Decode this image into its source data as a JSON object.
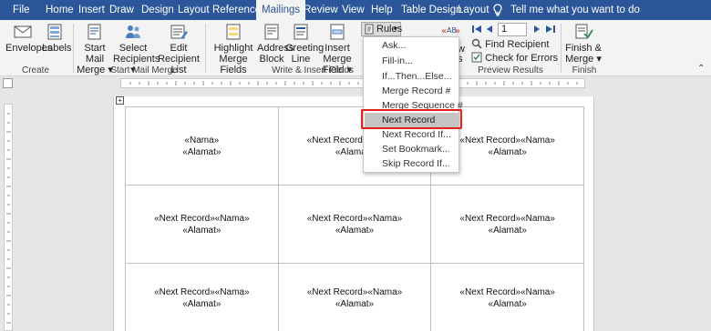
{
  "tabs": [
    {
      "label": "File",
      "left": 0
    },
    {
      "label": "Home"
    },
    {
      "label": "Insert"
    },
    {
      "label": "Draw"
    },
    {
      "label": "Design"
    },
    {
      "label": "Layout"
    },
    {
      "label": "References"
    },
    {
      "label": "Mailings",
      "active": true
    },
    {
      "label": "Review"
    },
    {
      "label": "View"
    },
    {
      "label": "Help"
    },
    {
      "label": "Table Design"
    },
    {
      "label": "Layout"
    }
  ],
  "tell_me": "Tell me what you want to do",
  "ribbon": {
    "create": {
      "envelopes": "Envelopes",
      "labels": "Labels",
      "group": "Create"
    },
    "start_mail_merge": {
      "start_mail": "Start Mail",
      "merge": "Merge",
      "select": "Select",
      "recipients": "Recipients",
      "edit": "Edit",
      "recipient_list": "Recipient List",
      "group": "Start Mail Merge"
    },
    "write_insert": {
      "highlight": "Highlight",
      "merge_fields": "Merge Fields",
      "address": "Address",
      "block": "Block",
      "greeting": "Greeting",
      "line": "Line",
      "insert_merge": "Insert Merge",
      "field": "Field",
      "group": "Write & Insert Fields"
    },
    "rules_label": "Rules",
    "preview": {
      "find_recipient": "Find Recipient",
      "check_errors": "Check for Errors",
      "record_number": "1",
      "group": "Preview Results",
      "partial_label": "w",
      "partial_label2": "s"
    },
    "finish": {
      "finish": "Finish &",
      "merge": "Merge",
      "group": "Finish"
    }
  },
  "rules_menu": [
    {
      "label": "Ask...",
      "highlighted": false
    },
    {
      "label": "Fill-in...",
      "highlighted": false
    },
    {
      "label": "If...Then...Else...",
      "highlighted": false
    },
    {
      "label": "Merge Record #",
      "highlighted": false
    },
    {
      "label": "Merge Sequence #",
      "highlighted": false
    },
    {
      "label": "Next Record",
      "highlighted": true
    },
    {
      "label": "Next Record If...",
      "highlighted": false
    },
    {
      "label": "Set Bookmark...",
      "highlighted": false
    },
    {
      "label": "Skip Record If...",
      "highlighted": false
    }
  ],
  "document": {
    "rows": [
      [
        {
          "line1": "«Nama»",
          "line2": "«Alamat»"
        },
        {
          "line1": "«Next Record»«Nama»",
          "line2": "«Alamat»"
        },
        {
          "line1": "«Next Record»«Nama»",
          "line2": "«Alamat»"
        }
      ],
      [
        {
          "line1": "«Next Record»«Nama»",
          "line2": "«Alamat»"
        },
        {
          "line1": "«Next Record»«Nama»",
          "line2": "«Alamat»"
        },
        {
          "line1": "«Next Record»«Nama»",
          "line2": "«Alamat»"
        }
      ],
      [
        {
          "line1": "«Next Record»«Nama»",
          "line2": "«Alamat»"
        },
        {
          "line1": "«Next Record»«Nama»",
          "line2": "«Alamat»"
        },
        {
          "line1": "«Next Record»«Nama»",
          "line2": "«Alamat»"
        }
      ]
    ]
  },
  "colors": {
    "accent": "#2b579a",
    "highlight_box": "#e3221b"
  }
}
